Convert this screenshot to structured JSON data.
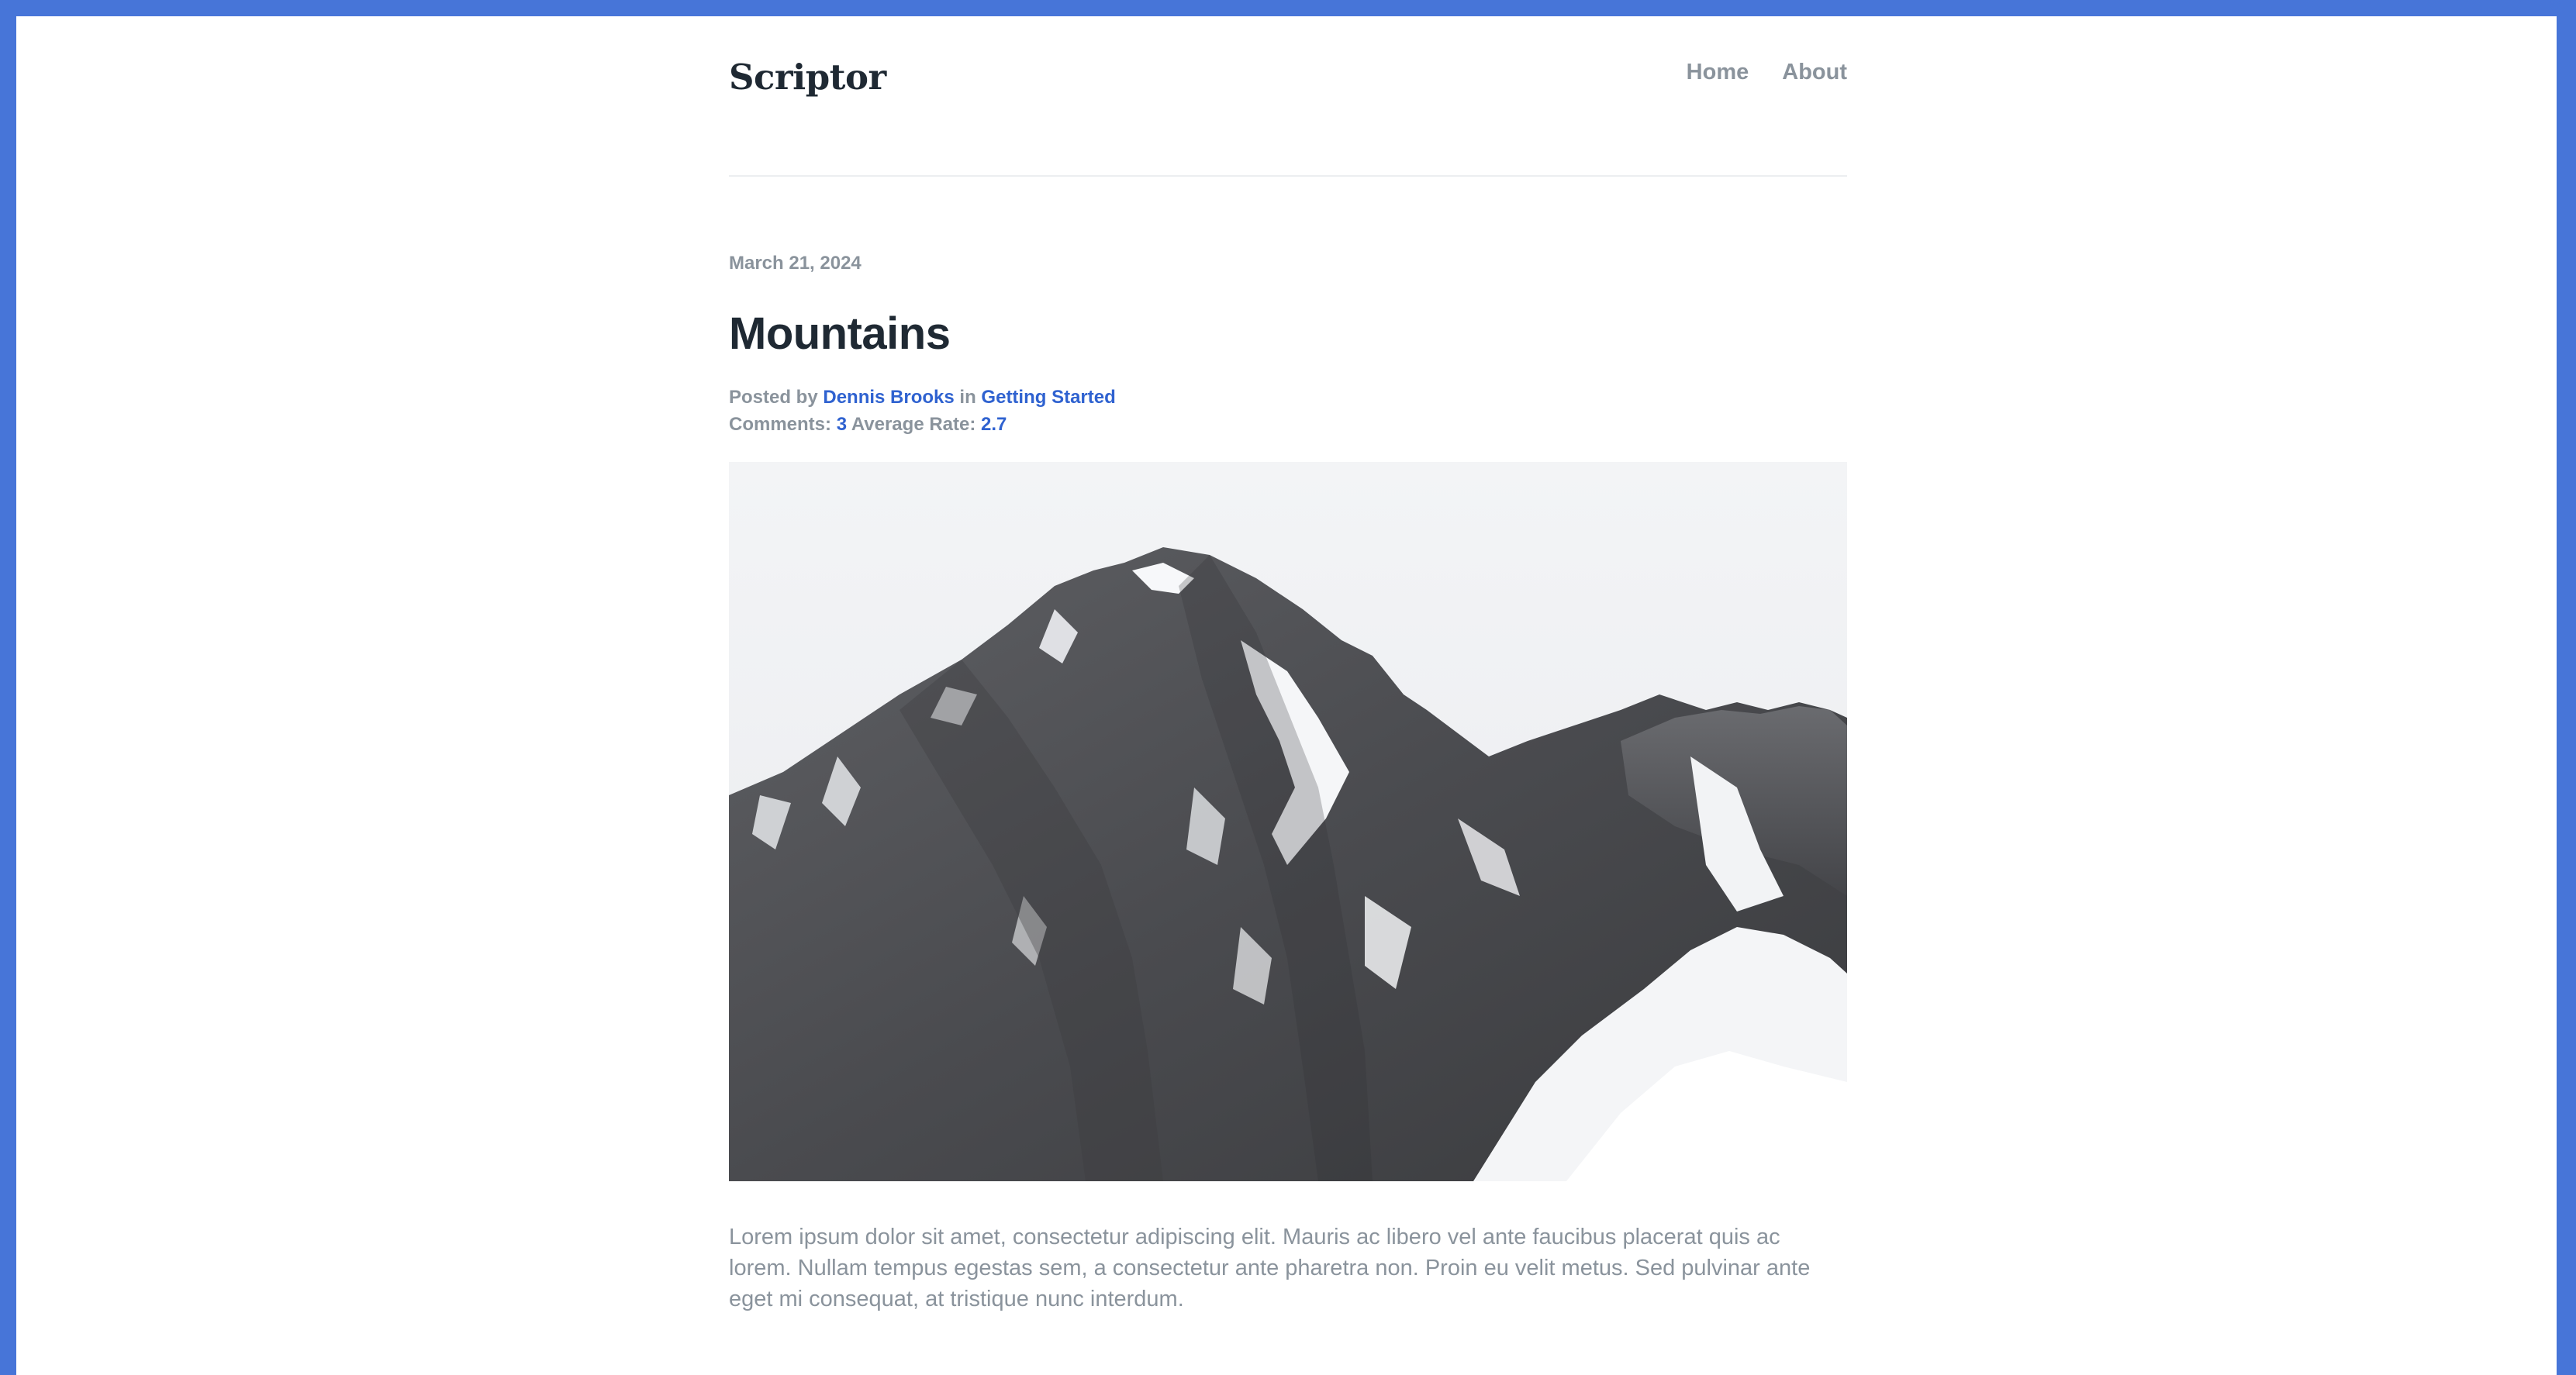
{
  "site": {
    "brand": "Scriptor",
    "nav": [
      {
        "label": "Home"
      },
      {
        "label": "About"
      }
    ]
  },
  "post": {
    "date": "March 21, 2024",
    "title": "Mountains",
    "posted_by_label": "Posted by",
    "author": "Dennis Brooks",
    "in_label": "in",
    "category": "Getting Started",
    "comments_label": "Comments:",
    "comments_count": "3",
    "average_rate_label": "Average Rate:",
    "average_rate": "2.7",
    "image": {
      "icon": "mountain-photo",
      "description_hidden": true
    },
    "body": "Lorem ipsum dolor sit amet, consectetur adipiscing elit. Mauris ac libero vel ante faucibus placerat quis ac lorem. Nullam tempus egestas sem, a consectetur ante pharetra non. Proin eu velit metus. Sed pulvinar ante eget mi consequat, at tristique nunc interdum."
  },
  "colors": {
    "frame": "#4775d8",
    "accent_link": "#2f62d0",
    "muted_text": "#8a939c",
    "heading_text": "#1f2933"
  }
}
